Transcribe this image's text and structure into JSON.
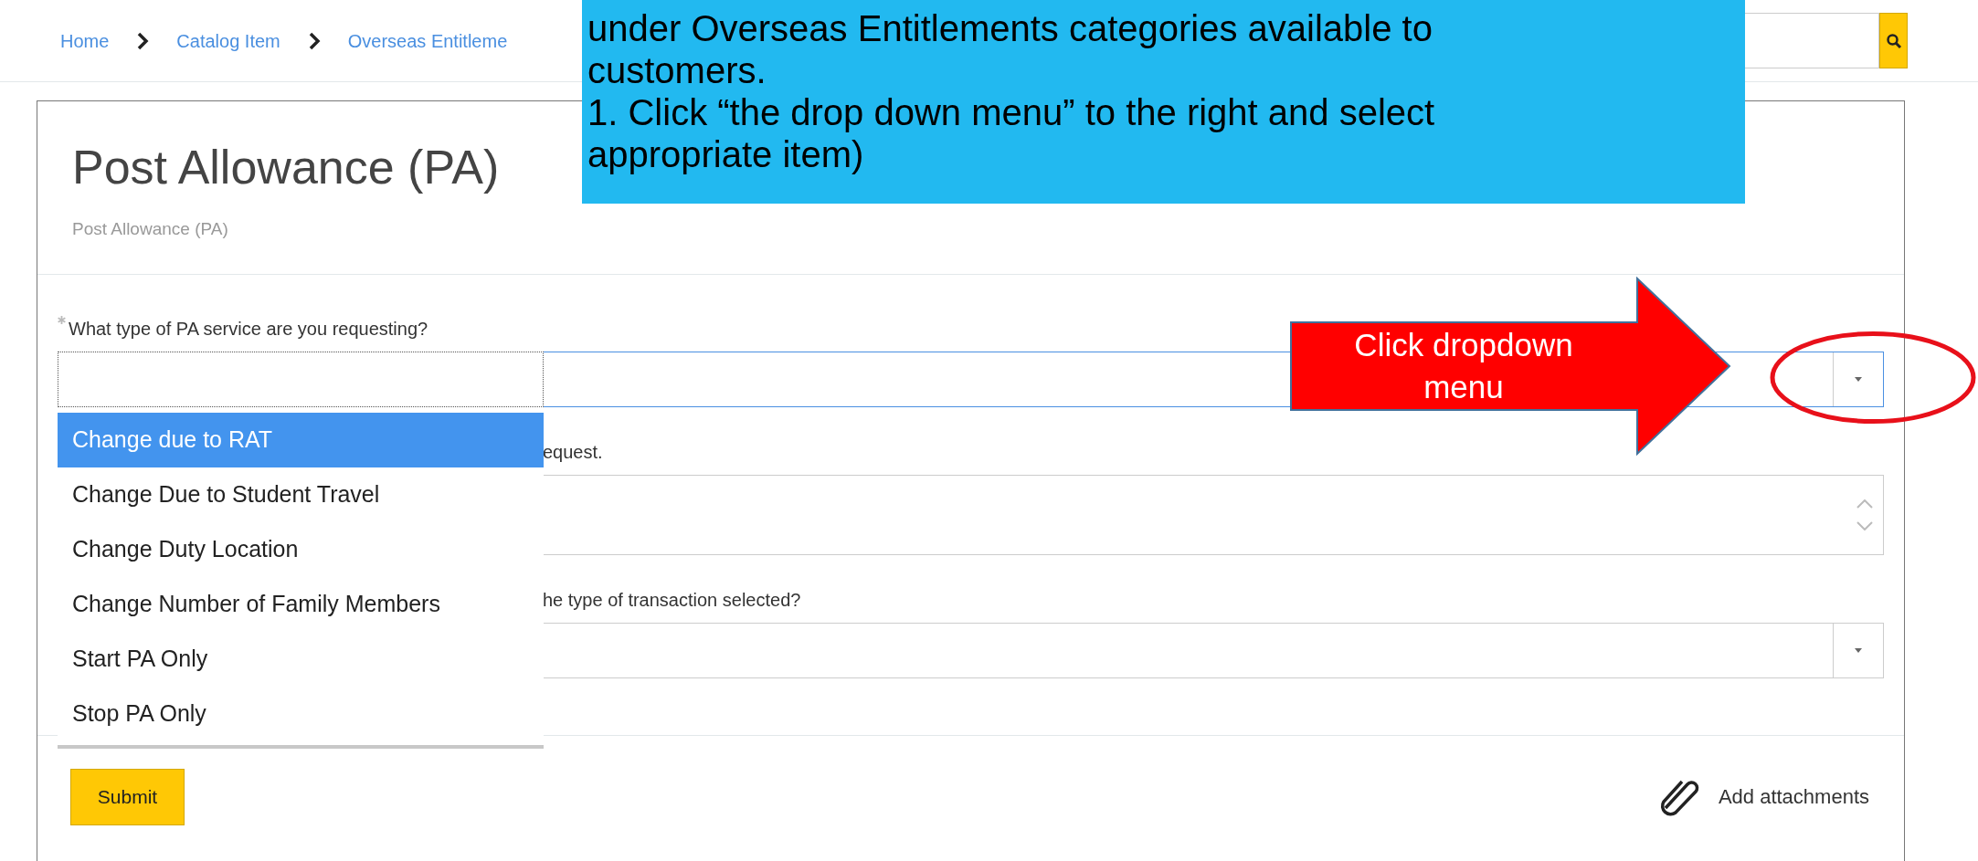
{
  "breadcrumb": [
    {
      "label": "Home"
    },
    {
      "label": "Catalog Item"
    },
    {
      "label": "Overseas Entitleme"
    }
  ],
  "callout": {
    "lines": [
      "under Overseas Entitlements categories available to",
      "customers.",
      "1. Click “the drop down menu” to the right and select",
      "appropriate item)"
    ]
  },
  "arrow_callout": {
    "label": "Click dropdown menu"
  },
  "page": {
    "title": "Post Allowance (PA)",
    "subtitle": "Post Allowance (PA)"
  },
  "fields": [
    {
      "kind": "select",
      "label": "What type of PA service are you requesting?",
      "required": true,
      "focused": true
    },
    {
      "kind": "textarea",
      "label": "equest."
    },
    {
      "kind": "select",
      "label": "he type of transaction selected?",
      "required": false,
      "focused": false
    }
  ],
  "dropdown": {
    "options": [
      {
        "label": "Change due to RAT",
        "selected": true
      },
      {
        "label": "Change Due to Student Travel",
        "selected": false
      },
      {
        "label": "Change Duty Location",
        "selected": false
      },
      {
        "label": "Change Number of Family Members",
        "selected": false
      },
      {
        "label": "Start PA Only",
        "selected": false
      },
      {
        "label": "Stop PA Only",
        "selected": false
      }
    ]
  },
  "actions": {
    "submit": "Submit",
    "attach": "Add attachments"
  }
}
